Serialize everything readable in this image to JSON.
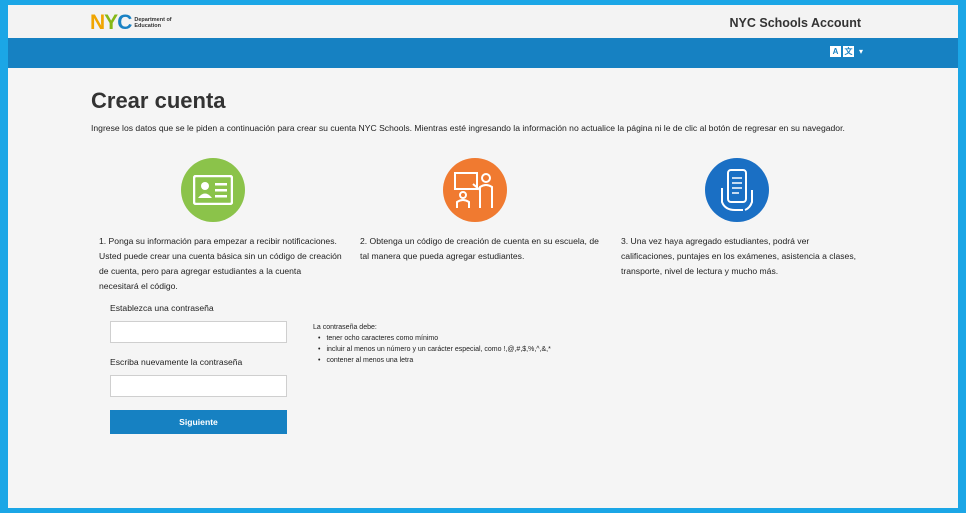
{
  "header": {
    "logo_letters": [
      "N",
      "Y",
      "C"
    ],
    "logo_line1": "Department of",
    "logo_line2": "Education",
    "account_title": "NYC Schools Account",
    "lang_icon": "translate-icon",
    "lang_glyph_a": "A",
    "lang_glyph_b": "文",
    "caret": "▾"
  },
  "page": {
    "title": "Crear cuenta",
    "intro": "Ingrese los datos que se le piden a continuación para crear su cuenta NYC Schools. Mientras esté ingresando la información no actualice la página ni le de clic al botón de regresar en su navegador."
  },
  "steps": [
    {
      "icon": "id-card-icon",
      "color": "#8bc34a",
      "text": "1. Ponga su información para empezar a recibir notificaciones. Usted puede crear una cuenta básica sin un código de creación de cuenta, pero para agregar estudiantes a la cuenta necesitará el código."
    },
    {
      "icon": "teacher-student-icon",
      "color": "#f07a30",
      "text": "2. Obtenga un código de creación de cuenta en su escuela, de tal manera que pueda agregar estudiantes."
    },
    {
      "icon": "phone-hand-icon",
      "color": "#1a6fc4",
      "text": "3. Una vez haya agregado estudiantes, podrá ver calificaciones, puntajes en los exámenes, asistencia a clases, transporte, nivel de lectura y mucho más."
    }
  ],
  "form": {
    "password_label": "Establezca una contraseña",
    "password_value": "",
    "confirm_label": "Escriba nuevamente la contraseña",
    "confirm_value": "",
    "submit_label": "Siguiente"
  },
  "rules": {
    "heading": "La contraseña debe:",
    "items": [
      "tener ocho caracteres como mínimo",
      "incluir al menos un número y un carácter especial, como !,@,#,$,%,^,&,*",
      "contener al menos una letra"
    ]
  },
  "colors": {
    "frame": "#1ba6e6",
    "bluebar": "#1681c2",
    "button": "#1681c2"
  }
}
